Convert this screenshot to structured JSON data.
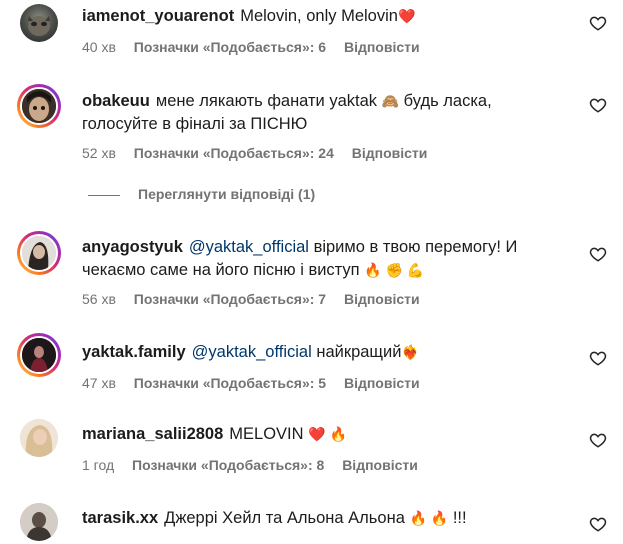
{
  "comments": [
    {
      "username": "iamenot_youarenot",
      "mention": "",
      "text": "Melovin, only Melovin",
      "text2": "",
      "emojis": "❤️",
      "time": "40 хв",
      "likes": "Позначки «Подобається»: 6",
      "reply": "Відповісти",
      "avatar_ring": false
    },
    {
      "username": "obakeuu",
      "mention": "",
      "text": "мене лякають фанати yaktak",
      "emojis": "🙈",
      "text_after_emoji": "будь ласка,",
      "text2": "голосуйте в фіналі за ПІСНЮ",
      "time": "52 хв",
      "likes": "Позначки «Подобається»: 24",
      "reply": "Відповісти",
      "avatar_ring": true
    },
    {
      "username": "anyagostyuk",
      "mention": "@yaktak_official",
      "text": "віримо в твою перемогу! И",
      "text2": "чекаємо саме на його пісню і виступ",
      "emojis": "🔥 ✊ 💪",
      "time": "56 хв",
      "likes": "Позначки «Подобається»: 7",
      "reply": "Відповісти",
      "avatar_ring": true
    },
    {
      "username": "yaktak.family",
      "mention": "@yaktak_official",
      "text": "найкращий",
      "text2": "",
      "emojis": "❤️‍🔥",
      "time": "47 хв",
      "likes": "Позначки «Подобається»: 5",
      "reply": "Відповісти",
      "avatar_ring": true
    },
    {
      "username": "mariana_salii2808",
      "mention": "",
      "text": "MELOVIN",
      "text2": "",
      "emojis": "❤️ 🔥",
      "time": "1 год",
      "likes": "Позначки «Подобається»: 8",
      "reply": "Відповісти",
      "avatar_ring": false
    },
    {
      "username": "tarasik.xx",
      "mention": "",
      "text": "Джеррі Хейл та Альона Альона",
      "text2": "",
      "emojis": "🔥 🔥",
      "text_after_emoji": "!!!",
      "avatar_ring": false
    }
  ],
  "view_replies": "Переглянути відповіді (1)",
  "icons": {
    "like": "heart-outline-icon"
  },
  "colors": {
    "meta": "#737373",
    "mention": "#00376b"
  }
}
